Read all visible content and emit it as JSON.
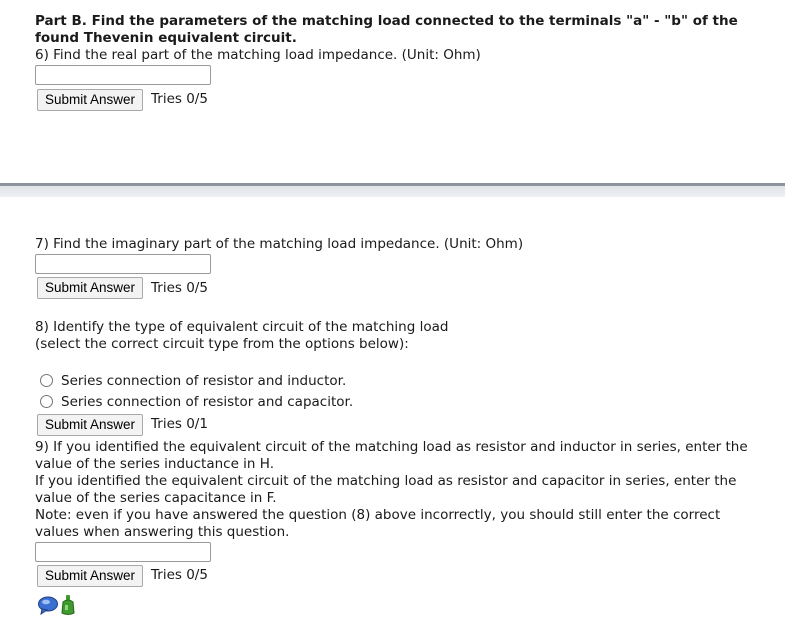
{
  "part_b": {
    "heading_line1": "Part B. Find the parameters of the matching load connected to the terminals \"a\" - \"b\" of the",
    "heading_line2": "found Thevenin equivalent circuit."
  },
  "q6": {
    "text": "6) Find the real part of the matching load impedance. (Unit: Ohm)",
    "value": "",
    "submit_label": "Submit Answer",
    "tries": "Tries 0/5"
  },
  "q7": {
    "text": "7) Find the imaginary part of the matching load impedance. (Unit: Ohm)",
    "value": "",
    "submit_label": "Submit Answer",
    "tries": "Tries 0/5"
  },
  "q8": {
    "text_line1": "8) Identify the type of equivalent circuit of the matching load",
    "text_line2": "(select the correct circuit type from the options below):",
    "options": [
      "Series connection of resistor and inductor.",
      "Series connection of resistor and capacitor."
    ],
    "submit_label": "Submit Answer",
    "tries": "Tries 0/1"
  },
  "q9": {
    "line1": "9) If you identified the equivalent circuit of the matching load as resistor and inductor in series, enter the",
    "line2": "value of the series inductance in H.",
    "line3": "If you identified the equivalent circuit of the matching load as resistor and capacitor in series, enter the",
    "line4": "value of the series capacitance in F.",
    "line5": "Note: even if you have answered the question (8) above incorrectly, you should still enter the correct",
    "line6": "values when answering this question.",
    "value": "",
    "submit_label": "Submit Answer",
    "tries": "Tries 0/5"
  },
  "colors": {
    "divider": "#8d939c",
    "hint_green": "#3f9b2e",
    "feedback_blue": "#3b6fd1"
  },
  "icons": [
    "feedback-icon",
    "hint-icon"
  ]
}
